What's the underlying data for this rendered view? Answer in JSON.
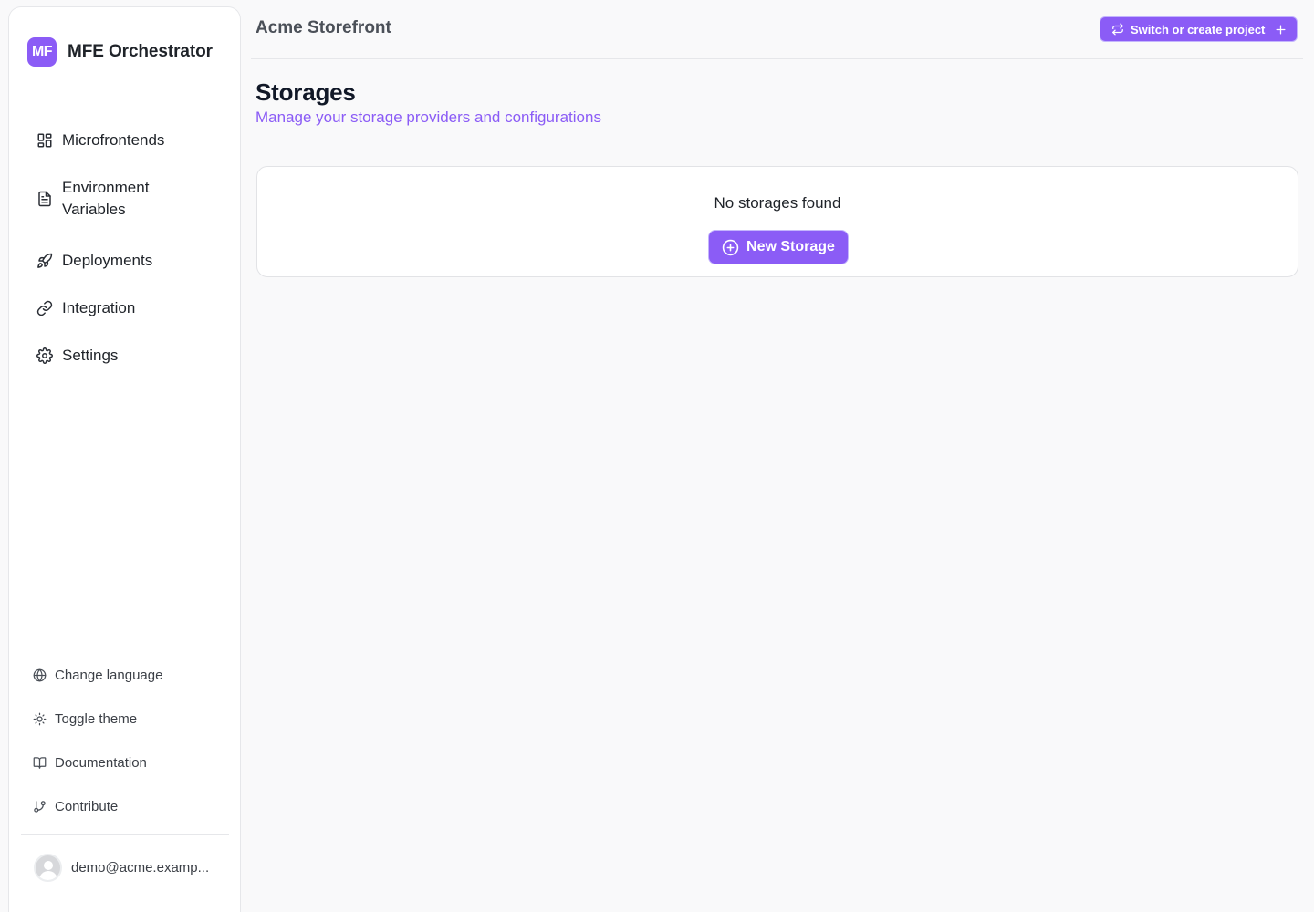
{
  "brand": {
    "logo": "MF",
    "name": "MFE Orchestrator",
    "accent": "#8b5cf6"
  },
  "sidebar": {
    "nav": [
      {
        "label": "Microfrontends",
        "icon": "grid-icon"
      },
      {
        "label": "Environment\nVariables",
        "icon": "document-icon"
      },
      {
        "label": "Deployments",
        "icon": "rocket-icon"
      },
      {
        "label": "Integration",
        "icon": "link-icon"
      },
      {
        "label": "Settings",
        "icon": "gear-icon"
      }
    ],
    "utilities": [
      {
        "label": "Change language",
        "icon": "globe-icon"
      },
      {
        "label": "Toggle theme",
        "icon": "sun-icon"
      },
      {
        "label": "Documentation",
        "icon": "book-icon"
      },
      {
        "label": "Contribute",
        "icon": "git-branch-icon"
      }
    ],
    "user": {
      "email": "demo@acme.examp..."
    }
  },
  "header": {
    "project_name": "Acme Storefront",
    "switch_button": "Switch or create project"
  },
  "main": {
    "title": "Storages",
    "subtitle": "Manage your storage providers and configurations",
    "empty_state": {
      "message": "No storages found",
      "button": "New Storage"
    }
  }
}
